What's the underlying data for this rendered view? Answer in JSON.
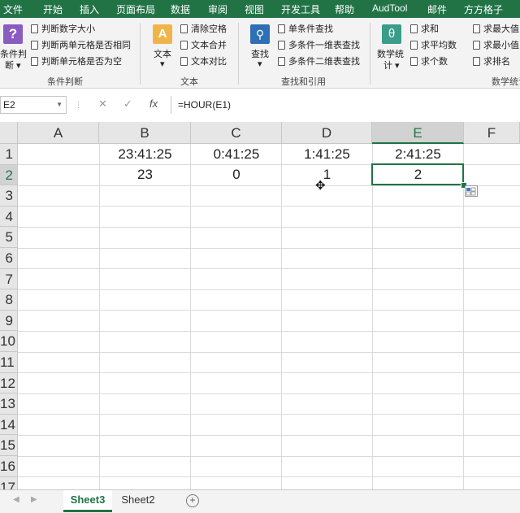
{
  "ribbon_tabs": [
    "文件",
    "开始",
    "插入",
    "页面布局",
    "数据",
    "审阅",
    "视图",
    "开发工具",
    "帮助",
    "AudTool",
    "邮件",
    "方方格子"
  ],
  "ribbon": {
    "cond_group": {
      "big_label_line1": "条件判",
      "big_label_line2": "断",
      "items": [
        "判断数字大小",
        "判断两单元格是否相同",
        "判断单元格是否为空"
      ],
      "label": "条件判断"
    },
    "text_group": {
      "big_label": "文本",
      "items": [
        "清除空格",
        "文本合并",
        "文本对比"
      ],
      "label": "文本"
    },
    "lookup_group": {
      "big_label": "查找",
      "items": [
        "单条件查找",
        "多条件一维表查找",
        "多条件二维表查找"
      ],
      "label": "查找和引用"
    },
    "math_group": {
      "big_label_line1": "数学统",
      "big_label_line2": "计",
      "items_col1": [
        "求和",
        "求平均数",
        "求个数"
      ],
      "items_col2": [
        "求最大值",
        "求最小值",
        "求排名"
      ],
      "label": "数学统计"
    }
  },
  "formula_bar": {
    "name_box": "E2",
    "formula": "=HOUR(E1)"
  },
  "grid": {
    "columns": [
      "A",
      "B",
      "C",
      "D",
      "E",
      "F"
    ],
    "rows": [
      "1",
      "2",
      "3",
      "4",
      "5",
      "6",
      "7",
      "8",
      "9",
      "10",
      "11",
      "12",
      "13",
      "14",
      "15",
      "16",
      "17"
    ],
    "cells": {
      "B1": "23:41:25",
      "C1": "0:41:25",
      "D1": "1:41:25",
      "E1": "2:41:25",
      "B2": "23",
      "C2": "0",
      "D2": "1",
      "E2": "2"
    },
    "selected_cell": "E2"
  },
  "sheets": [
    "Sheet3",
    "Sheet2"
  ],
  "active_sheet": "Sheet3",
  "colors": {
    "accent": "#217346"
  }
}
